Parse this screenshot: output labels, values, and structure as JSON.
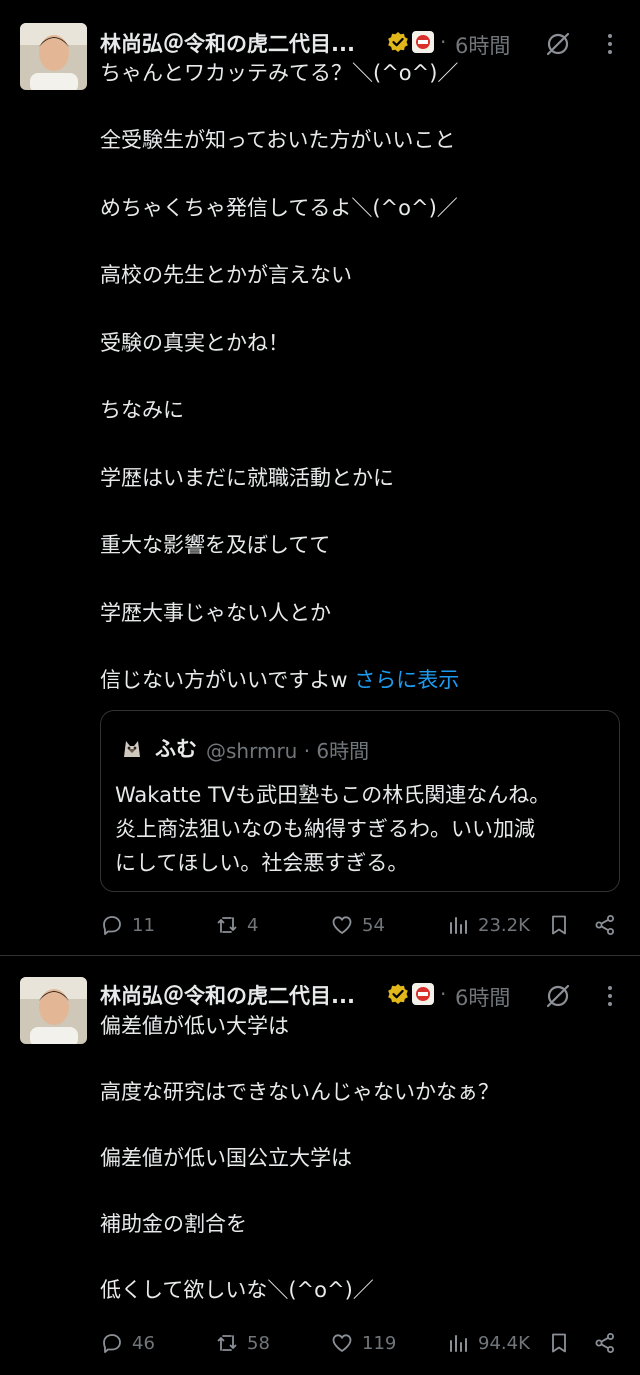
{
  "tweets": [
    {
      "author": "林尚弘＠令和の虎二代目...",
      "sep": "·",
      "time": "6時間",
      "lines": [
        "ちゃんとワカッテみてる？＼(^o^)／",
        "全受験生が知っておいた方がいいこと",
        "めちゃくちゃ発信してるよ＼(^o^)／",
        "高校の先生とかが言えない",
        "受験の真実とかね！",
        "ちなみに",
        "学歴はいまだに就職活動とかに",
        "重大な影響を及ぼしてて",
        "学歴大事じゃない人とか",
        "信じない方がいいですよw"
      ],
      "show_more": "さらに表示",
      "quote": {
        "name": "ふむ",
        "handle": "@shrmru · 6時間",
        "lines": [
          "Wakatte TVも武田塾もこの林氏関連なんね。",
          "炎上商法狙いなのも納得すぎるわ。いい加減",
          "にしてほしい。社会悪すぎる。"
        ]
      },
      "stats": {
        "replies": "11",
        "reposts": "4",
        "likes": "54",
        "views": "23.2K"
      }
    },
    {
      "author": "林尚弘＠令和の虎二代目...",
      "sep": "·",
      "time": "6時間",
      "lines": [
        "偏差値が低い大学は",
        "高度な研究はできないんじゃないかなぁ？",
        "偏差値が低い国公立大学は",
        "補助金の割合を",
        "低くして欲しいな＼(^o^)／"
      ],
      "stats": {
        "replies": "46",
        "reposts": "58",
        "likes": "119",
        "views": "94.4K"
      }
    }
  ],
  "colors": {
    "accent": "#1d9bf0",
    "muted": "#71767b",
    "text": "#e7e9ea",
    "verified": "#e2b719",
    "border": "#2f3336"
  },
  "icons": [
    "reply-icon",
    "repost-icon",
    "like-icon",
    "views-icon",
    "bookmark-icon",
    "share-icon",
    "grok-icon",
    "more-icon",
    "verified-icon"
  ]
}
